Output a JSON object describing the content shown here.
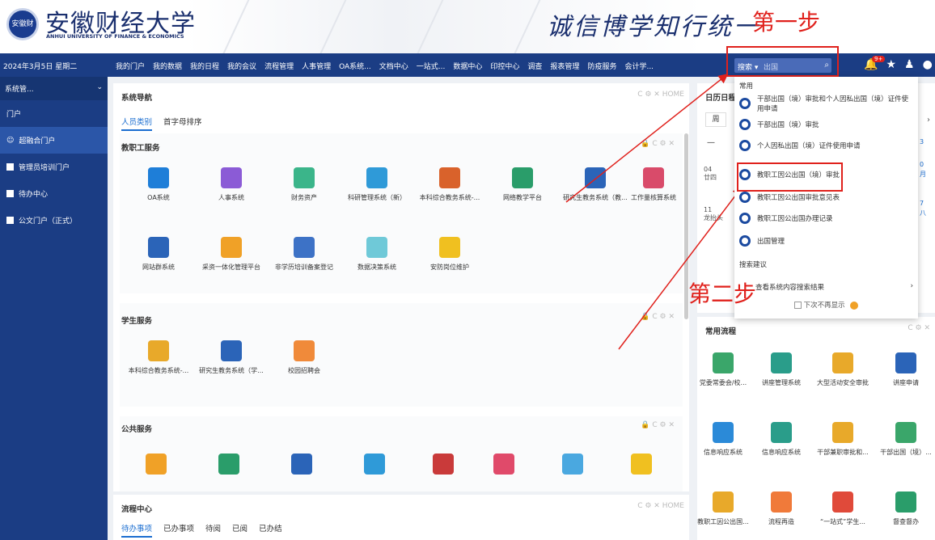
{
  "header": {
    "logo_emblem": "安徽财经大学",
    "logo_cn": "安徽财经大学",
    "logo_en": "ANHUI UNIVERSITY OF FINANCE & ECONOMICS",
    "motto": "诚信博学知行统一",
    "step1": "第一步",
    "step2": "第二步"
  },
  "navbar": {
    "date": "2024年3月5日 星期二",
    "menu": [
      "我的门户",
      "我的数据",
      "我的日程",
      "我的会议",
      "流程管理",
      "人事管理",
      "OA系统...",
      "文档中心",
      "一站式...",
      "数据中心",
      "印控中心",
      "调查",
      "报表管理",
      "防疫服务",
      "会计学..."
    ]
  },
  "search": {
    "scope": "搜索 ▾",
    "query": "出国",
    "button_icon": "search-icon"
  },
  "header_icons": {
    "badge": "9+",
    "bell": "🔔",
    "star": "★",
    "user": "♟",
    "menu": "●"
  },
  "sidebar": {
    "system": "系统管...",
    "system_chevron": "⌄",
    "items": [
      "门户",
      "超融合门户",
      "管理员培训门户",
      "待办中心",
      "公文门户（正式）"
    ]
  },
  "nav_card": {
    "title": "系统导航",
    "tools": "C ⚙ ✕ HOME",
    "tabs": [
      "人员类别",
      "首字母排序"
    ],
    "staff_title": "教职工服务",
    "section_tools": "🔒 C ⚙ ✕",
    "staff_apps": [
      "OA系统",
      "人事系统",
      "财务资产",
      "科研管理系统（新）",
      "本科综合教务系统-...",
      "网络教学平台",
      "研究生教务系统（教...",
      "工作量核算系统",
      "网站群系统",
      "采资一体化管理平台",
      "非学历培训备案登记",
      "数据决策系统",
      "安防岗位维护"
    ],
    "student_title": "学生服务",
    "student_apps": [
      "本科综合教务系统-...",
      "研究生教务系统（学...",
      "校园招聘会"
    ],
    "public_title": "公共服务"
  },
  "flow_card": {
    "title": "流程中心",
    "tools": "C ⚙ ✕ HOME",
    "tabs": [
      "待办事项",
      "已办事项",
      "待阅",
      "已阅",
      "已办结"
    ]
  },
  "calendar": {
    "title": "日历日程",
    "btn_week": "周",
    "dash": "—",
    "rows": [
      {
        "day": "04",
        "lunar": "廿四"
      },
      {
        "day": "11",
        "lunar": "龙抬头"
      }
    ],
    "right": [
      "3",
      "0",
      "月",
      "7",
      "八"
    ],
    "arrow": "›"
  },
  "common": {
    "title": "常用流程",
    "tools": "C ⚙ ✕",
    "apps": [
      "党委常委会/校...",
      "讲座管理系统",
      "大型活动安全审批",
      "讲座申请",
      "信息响应系统",
      "信息响应系统",
      "干部兼职审批和...",
      "干部出国（境）...",
      "教职工因公出国...",
      "流程再造",
      "“一站式”学生...",
      "督查督办"
    ]
  },
  "dropdown": {
    "group": "常用",
    "items": [
      "干部出国（境）审批和个人因私出国（境）证件使用申请",
      "干部出国（境）审批",
      "个人因私出国（境）证件使用申请",
      "教职工因公出国（境）审批",
      "教职工因公出国审批意见表",
      "教职工因公出国办理记录",
      "出国管理"
    ],
    "suggest_title": "搜索建议",
    "suggest": "查看系统内容搜索结果",
    "suggest_arrow": "›",
    "footer": "下次不再显示"
  },
  "colors": {
    "nav": "#1b3d84",
    "red": "#e0211c",
    "link": "#1b6ed0"
  }
}
